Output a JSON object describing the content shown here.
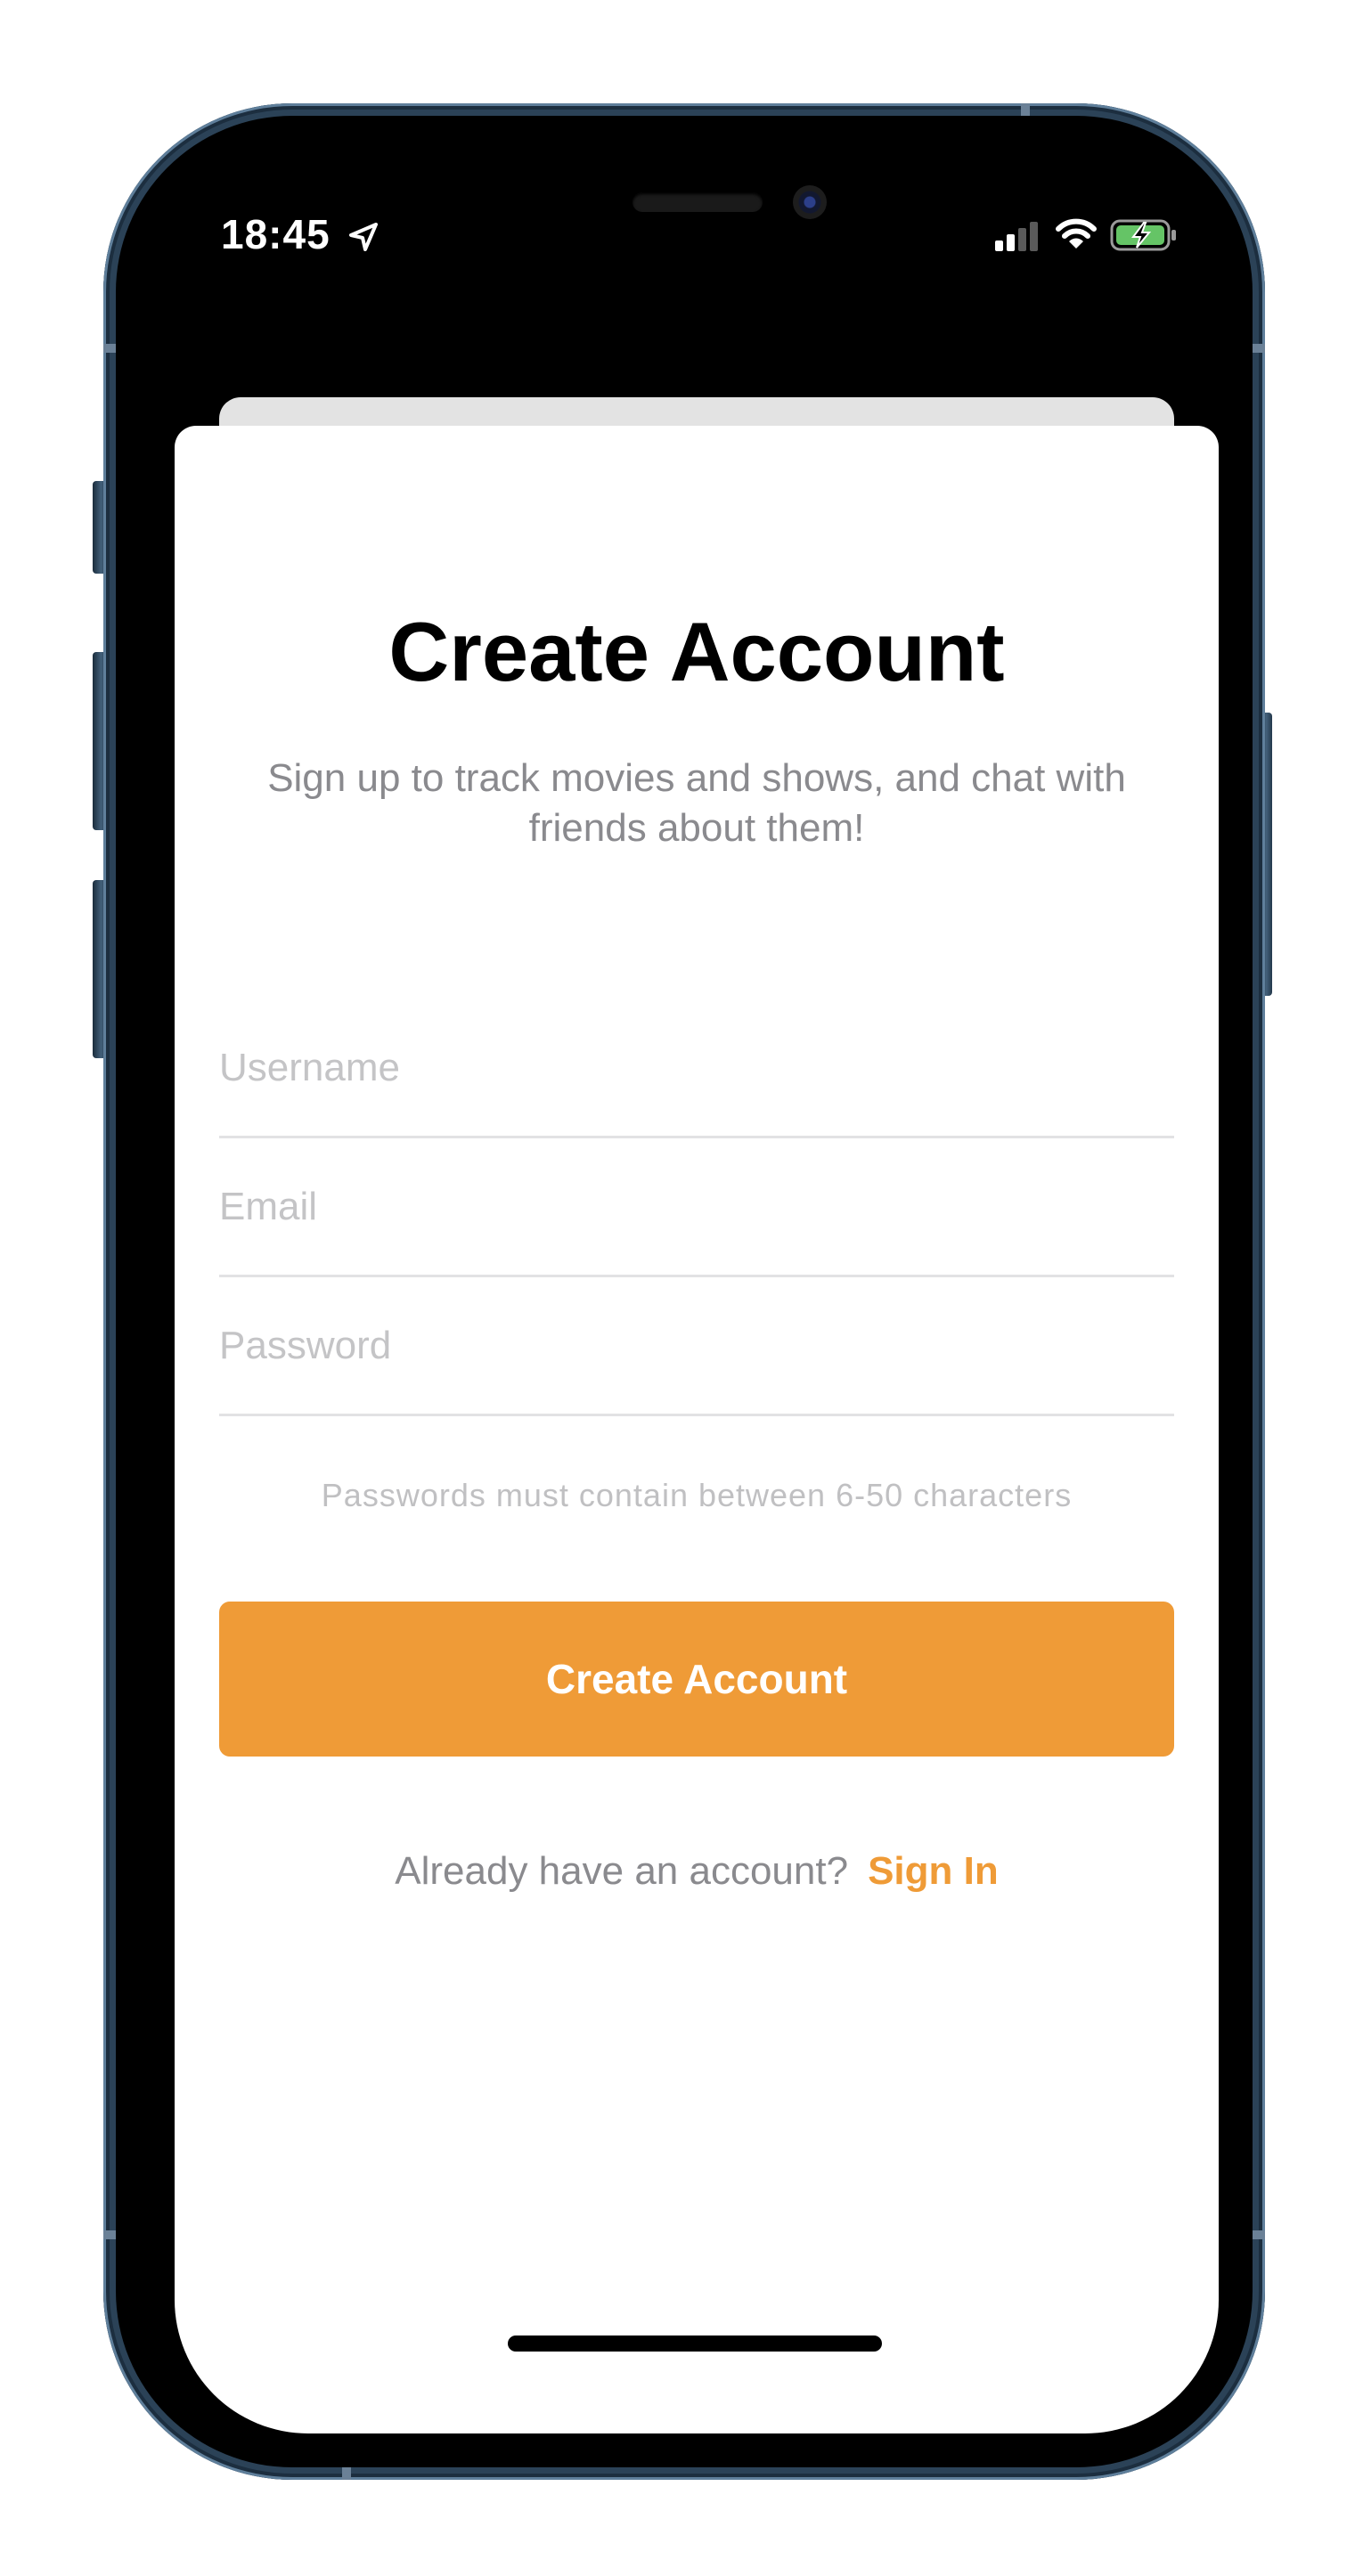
{
  "status_bar": {
    "time": "18:45",
    "icons": [
      "location-arrow-icon",
      "cellular-signal-icon",
      "wifi-icon",
      "battery-charging-icon"
    ]
  },
  "screen": {
    "title": "Create Account",
    "subtitle": "Sign up to track movies and shows, and chat with friends about them!",
    "fields": {
      "username": {
        "placeholder": "Username",
        "value": ""
      },
      "email": {
        "placeholder": "Email",
        "value": ""
      },
      "password": {
        "placeholder": "Password",
        "value": ""
      }
    },
    "password_hint": "Passwords must contain between 6-50 characters",
    "create_button_label": "Create Account",
    "signin_prompt": "Already have an account?",
    "signin_link": "Sign In"
  },
  "colors": {
    "accent": "#EF9B37",
    "title": "#000000",
    "secondary_text": "#8A8A8E",
    "placeholder": "#C4C4C6",
    "divider": "#E2E2E4",
    "sheet_background": "#FFFFFF",
    "device_frame": "#2B4257"
  }
}
